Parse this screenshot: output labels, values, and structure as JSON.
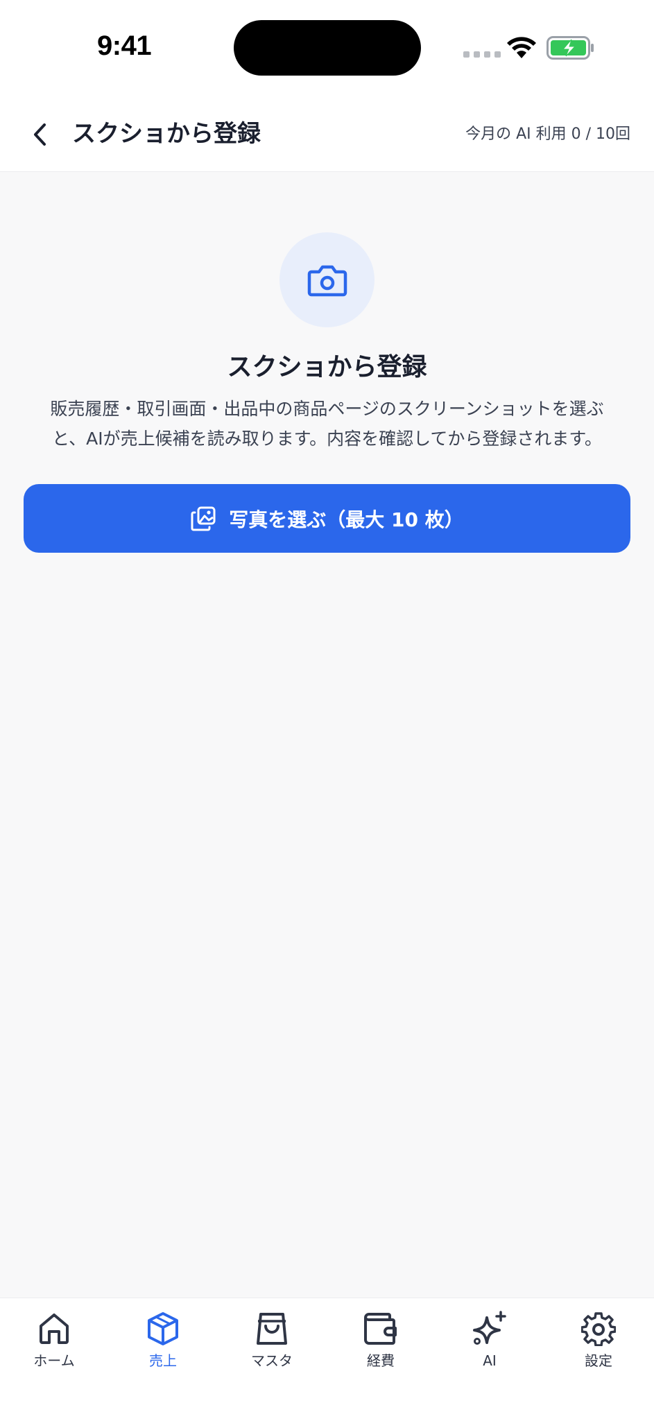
{
  "status_bar": {
    "time": "9:41"
  },
  "header": {
    "title": "スクショから登録",
    "usage": "今月の AI 利用 0 / 10回"
  },
  "main": {
    "icon": "camera-icon",
    "title": "スクショから登録",
    "description": "販売履歴・取引画面・出品中の商品ページのスクリーンショットを選ぶと、AIが売上候補を読み取ります。内容を確認してから登録されます。",
    "pick_button_label": "写真を選ぶ（最大 10 枚）"
  },
  "tabbar": {
    "items": [
      {
        "label": "ホーム",
        "icon": "home-icon",
        "active": false
      },
      {
        "label": "売上",
        "icon": "box-icon",
        "active": true
      },
      {
        "label": "マスタ",
        "icon": "shopping-bag-icon",
        "active": false
      },
      {
        "label": "経費",
        "icon": "wallet-icon",
        "active": false
      },
      {
        "label": "AI",
        "icon": "sparkles-icon",
        "active": false
      },
      {
        "label": "設定",
        "icon": "gear-icon",
        "active": false
      }
    ]
  },
  "colors": {
    "accent": "#2b67eb",
    "icon_bg": "#e8eefb",
    "background": "#f8f8f9"
  }
}
